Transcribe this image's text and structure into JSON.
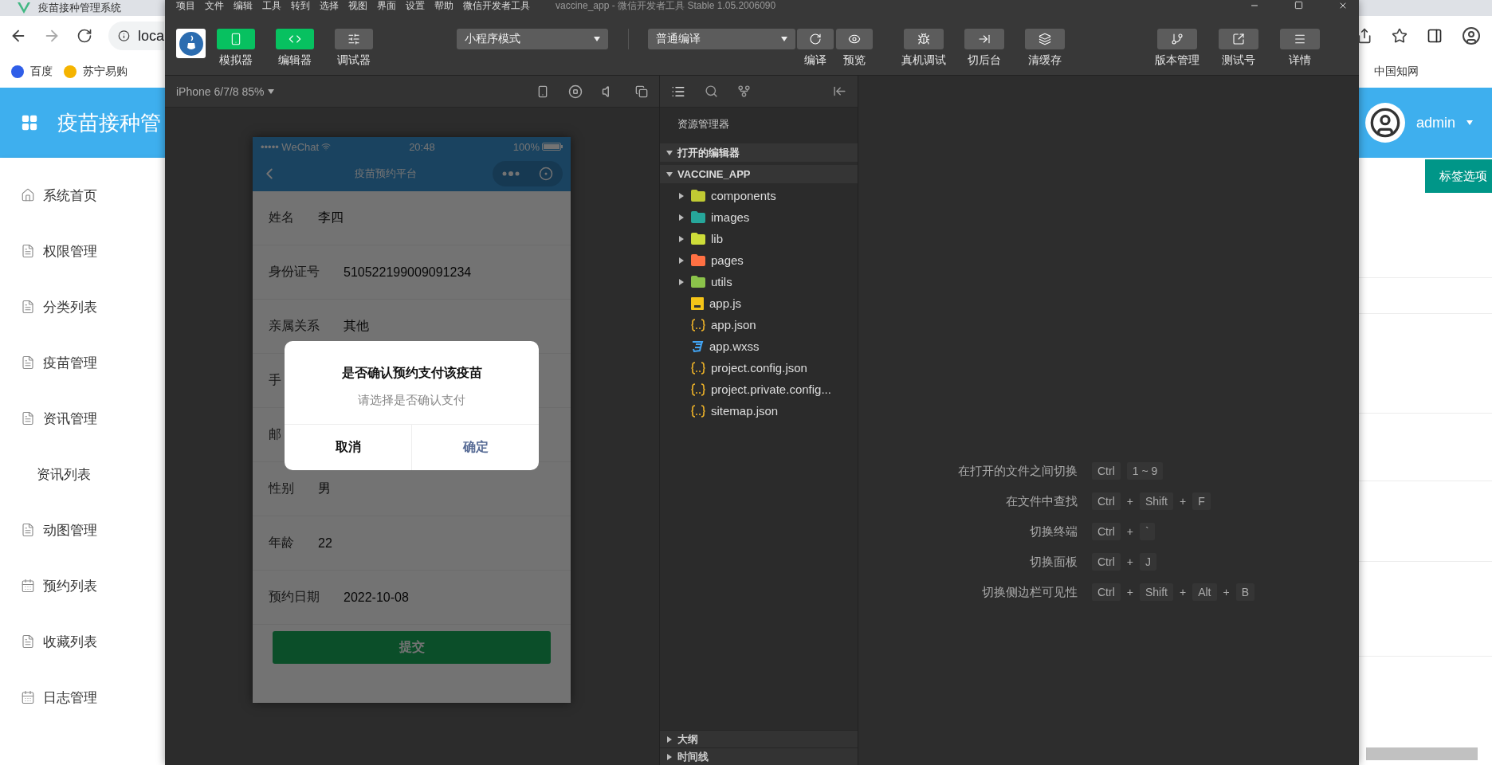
{
  "browser": {
    "tab_title": "疫苗接种管理系统",
    "address": "loca",
    "bookmarks_left": [
      {
        "label": "百度",
        "color": "#2f5ee8"
      },
      {
        "label": "苏宁易购",
        "color": "#f5b400"
      }
    ],
    "bookmarks_right": [
      {
        "label": "中国知网"
      }
    ]
  },
  "app": {
    "title": "疫苗接种管",
    "user": "admin",
    "tag_button": "标签选项",
    "menu": [
      {
        "label": "系统首页",
        "kind": "home"
      },
      {
        "label": "权限管理",
        "kind": "doc"
      },
      {
        "label": "分类列表",
        "kind": "doc"
      },
      {
        "label": "疫苗管理",
        "kind": "doc"
      },
      {
        "label": "资讯管理",
        "kind": "doc"
      },
      {
        "label": "资讯列表",
        "kind": "sub"
      },
      {
        "label": "动图管理",
        "kind": "doc"
      },
      {
        "label": "预约列表",
        "kind": "calendar"
      },
      {
        "label": "收藏列表",
        "kind": "doc"
      },
      {
        "label": "日志管理",
        "kind": "calendar"
      }
    ]
  },
  "devtools": {
    "menus": [
      "项目",
      "文件",
      "编辑",
      "工具",
      "转到",
      "选择",
      "视图",
      "界面",
      "设置",
      "帮助",
      "微信开发者工具"
    ],
    "window_title": "vaccine_app - 微信开发者工具 Stable 1.05.2006090",
    "views": [
      {
        "label": "模拟器",
        "selected": true
      },
      {
        "label": "编辑器",
        "selected": true
      },
      {
        "label": "调试器",
        "selected": false
      }
    ],
    "mode": "小程序模式",
    "compile": "普通编译",
    "compile_actions": [
      {
        "label": "编译"
      },
      {
        "label": "预览"
      }
    ],
    "actions": [
      {
        "label": "真机调试"
      },
      {
        "label": "切后台"
      },
      {
        "label": "清缓存"
      }
    ],
    "right_actions": [
      {
        "label": "版本管理"
      },
      {
        "label": "测试号"
      },
      {
        "label": "详情"
      }
    ]
  },
  "simulator": {
    "device": "iPhone 6/7/8 85%",
    "carrier": "••••• WeChat",
    "time": "20:48",
    "battery": "100%",
    "page_title": "疫苗预约平台",
    "fields": [
      {
        "label": "姓名",
        "value": "李四"
      },
      {
        "label": "身份证号",
        "value": "510522199009091234"
      },
      {
        "label": "亲属关系",
        "value": "其他"
      },
      {
        "label": "手"
      },
      {
        "label": "邮"
      },
      {
        "label": "性别",
        "value": "男"
      },
      {
        "label": "年龄",
        "value": "22"
      },
      {
        "label": "预约日期",
        "value": "2022-10-08"
      }
    ],
    "submit": "提交",
    "dialog": {
      "title": "是否确认预约支付该疫苗",
      "message": "请选择是否确认支付",
      "cancel": "取消",
      "confirm": "确定"
    }
  },
  "explorer": {
    "title": "资源管理器",
    "sections": [
      {
        "label": "打开的编辑器",
        "expanded": true
      },
      {
        "label": "VACCINE_APP",
        "expanded": true
      }
    ],
    "tree": [
      {
        "label": "components",
        "kind": "folder",
        "color": "#c0ca33",
        "expanded": false
      },
      {
        "label": "images",
        "kind": "folder",
        "color": "#26a69a",
        "expanded": false
      },
      {
        "label": "lib",
        "kind": "folder",
        "color": "#cddc39",
        "expanded": false
      },
      {
        "label": "pages",
        "kind": "folder",
        "color": "#ff7043",
        "expanded": false
      },
      {
        "label": "utils",
        "kind": "folder",
        "color": "#8bc34a",
        "expanded": false
      },
      {
        "label": "app.js",
        "kind": "js"
      },
      {
        "label": "app.json",
        "kind": "json"
      },
      {
        "label": "app.wxss",
        "kind": "wxss"
      },
      {
        "label": "project.config.json",
        "kind": "json"
      },
      {
        "label": "project.private.config...",
        "kind": "json"
      },
      {
        "label": "sitemap.json",
        "kind": "json"
      }
    ],
    "panels": [
      {
        "label": "大纲",
        "expanded": false
      },
      {
        "label": "时间线",
        "expanded": false
      }
    ]
  },
  "shortcuts": [
    {
      "label": "在打开的文件之间切换",
      "keys": [
        {
          "kind": "key",
          "text": "Ctrl"
        },
        {
          "kind": "key",
          "text": "1 ~ 9"
        }
      ]
    },
    {
      "label": "在文件中查找",
      "keys": [
        {
          "kind": "key",
          "text": "Ctrl"
        },
        {
          "kind": "plus",
          "text": "+"
        },
        {
          "kind": "key",
          "text": "Shift"
        },
        {
          "kind": "plus",
          "text": "+"
        },
        {
          "kind": "key",
          "text": "F"
        }
      ]
    },
    {
      "label": "切换终端",
      "keys": [
        {
          "kind": "key",
          "text": "Ctrl"
        },
        {
          "kind": "plus",
          "text": "+"
        },
        {
          "kind": "key",
          "text": "`"
        }
      ]
    },
    {
      "label": "切换面板",
      "keys": [
        {
          "kind": "key",
          "text": "Ctrl"
        },
        {
          "kind": "plus",
          "text": "+"
        },
        {
          "kind": "key",
          "text": "J"
        }
      ]
    },
    {
      "label": "切换侧边栏可见性",
      "keys": [
        {
          "kind": "key",
          "text": "Ctrl"
        },
        {
          "kind": "plus",
          "text": "+"
        },
        {
          "kind": "key",
          "text": "Shift"
        },
        {
          "kind": "plus",
          "text": "+"
        },
        {
          "kind": "key",
          "text": "Alt"
        },
        {
          "kind": "plus",
          "text": "+"
        },
        {
          "kind": "key",
          "text": "B"
        }
      ]
    }
  ]
}
